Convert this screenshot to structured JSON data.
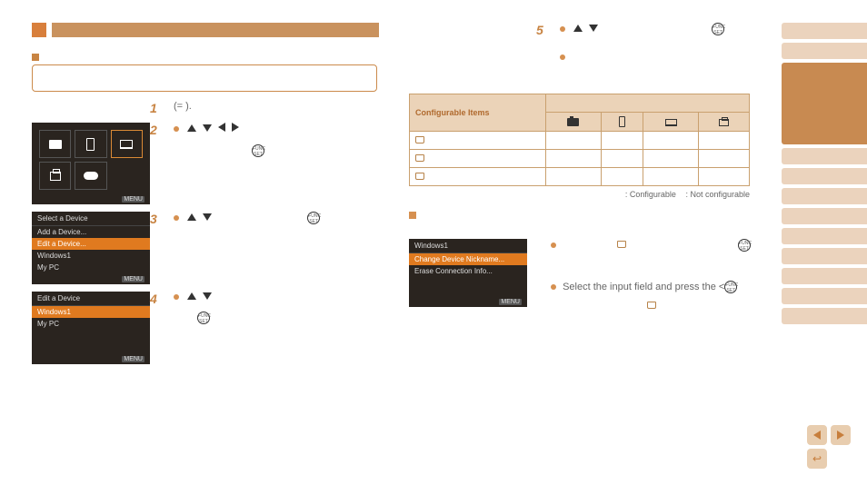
{
  "step_labels": {
    "s1": "1",
    "s2": "2",
    "s3": "3",
    "s4": "4",
    "s5": "5"
  },
  "cross_ref": "(=       ).",
  "cam_menu_label": "MENU",
  "screenshot2": {
    "title": "Select a Device",
    "items": [
      "Add a Device...",
      "Edit a Device...",
      "Windows1",
      "My PC"
    ]
  },
  "screenshot3": {
    "title": "Edit a Device",
    "items": [
      "Windows1",
      "My PC"
    ]
  },
  "screenshot4": {
    "title": "Windows1",
    "items": [
      "Change Device Nickname...",
      "Erase Connection Info..."
    ]
  },
  "func_label": "FUNC\nSET",
  "table": {
    "header": "Configurable Items",
    "legend_config": ": Configurable",
    "legend_notconfig": ": Not configurable"
  },
  "right_text": {
    "select_input": "Select the input field and press the <"
  },
  "nav": {
    "back_icon": "↩"
  }
}
